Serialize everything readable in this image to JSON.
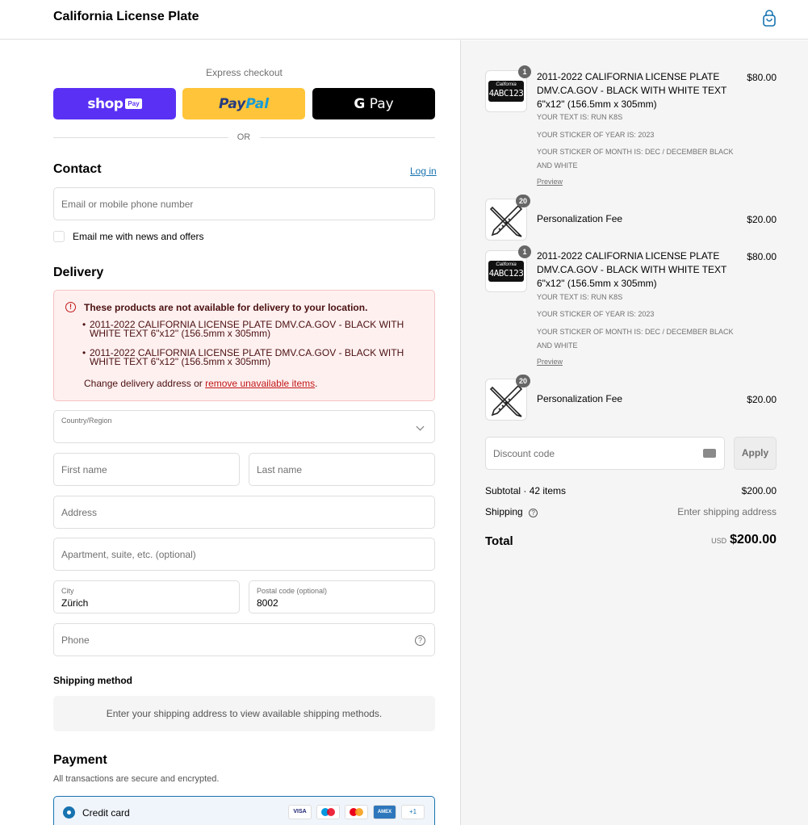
{
  "header": {
    "store_name": "California License Plate"
  },
  "express": {
    "title": "Express checkout",
    "shop_pay": {
      "word": "shop",
      "tag": "Pay"
    },
    "paypal": {
      "part1": "Pay",
      "part2": "Pal"
    },
    "gpay": {
      "g": "G",
      "word": " Pay"
    },
    "or_text": "OR"
  },
  "contact": {
    "title": "Contact",
    "login_label": "Log in",
    "email_placeholder": "Email or mobile phone number",
    "newsletter_label": "Email me with news and offers"
  },
  "delivery": {
    "title": "Delivery",
    "warning": {
      "title": "These products are not available for delivery to your location.",
      "items": [
        "2011-2022 CALIFORNIA LICENSE PLATE DMV.CA.GOV - BLACK WITH WHITE TEXT 6\"x12\" (156.5mm x 305mm)",
        "2011-2022 CALIFORNIA LICENSE PLATE DMV.CA.GOV - BLACK WITH WHITE TEXT 6\"x12\" (156.5mm x 305mm)"
      ],
      "footer_prefix": "Change delivery address or ",
      "footer_link": "remove unavailable items",
      "footer_suffix": "."
    },
    "country_label": "Country/Region",
    "first_name_placeholder": "First name",
    "last_name_placeholder": "Last name",
    "address_placeholder": "Address",
    "apartment_placeholder": "Apartment, suite, etc. (optional)",
    "city_label": "City",
    "city_value": "Zürich",
    "postal_label": "Postal code (optional)",
    "postal_value": "8002",
    "phone_placeholder": "Phone"
  },
  "shipping_method": {
    "title": "Shipping method",
    "message": "Enter your shipping address to view available shipping methods."
  },
  "payment": {
    "title": "Payment",
    "subtitle": "All transactions are secure and encrypted.",
    "credit_card_label": "Credit card",
    "card_logos": [
      "VISA",
      "AMEX",
      "+1"
    ]
  },
  "order": {
    "items": [
      {
        "badge": "1",
        "plate_state": "California",
        "plate_number": "4ABC123",
        "title": "2011-2022 CALIFORNIA LICENSE PLATE DMV.CA.GOV - BLACK WITH WHITE TEXT 6\"x12\" (156.5mm x 305mm)",
        "price": "$80.00",
        "meta": [
          "YOUR TEXT IS: RUN K8S",
          "YOUR STICKER OF YEAR IS: 2023",
          "YOUR STICKER OF MONTH IS: DEC / DECEMBER BLACK AND WHITE"
        ],
        "link": "Preview"
      },
      {
        "badge": "20",
        "title": "Personalization Fee",
        "price": "$20.00"
      },
      {
        "badge": "1",
        "plate_state": "California",
        "plate_number": "4ABC123",
        "title": "2011-2022 CALIFORNIA LICENSE PLATE DMV.CA.GOV - BLACK WITH WHITE TEXT 6\"x12\" (156.5mm x 305mm)",
        "price": "$80.00",
        "meta": [
          "YOUR TEXT IS: RUN K8S",
          "YOUR STICKER OF YEAR IS: 2023",
          "YOUR STICKER OF MONTH IS: DEC / DECEMBER BLACK AND WHITE"
        ],
        "link": "Preview"
      },
      {
        "badge": "20",
        "title": "Personalization Fee",
        "price": "$20.00"
      }
    ],
    "discount_placeholder": "Discount code",
    "apply_label": "Apply",
    "subtotal_label": "Subtotal · 42 items",
    "subtotal_value": "$200.00",
    "shipping_label": "Shipping",
    "shipping_value": "Enter shipping address",
    "total_label": "Total",
    "total_currency": "USD",
    "total_value": "$200.00"
  },
  "colors": {
    "accent": "#1773b0",
    "shop_pay": "#5a31f4",
    "paypal": "#ffc439",
    "error": "#c01818"
  }
}
